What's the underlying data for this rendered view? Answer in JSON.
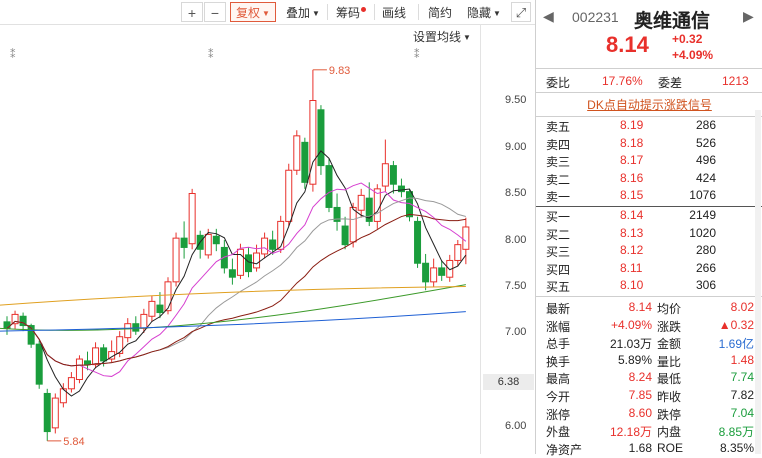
{
  "toolbar": {
    "glyphs": {
      "plus": "+",
      "minus": "−",
      "prev": "◀",
      "next": "▶"
    },
    "fuquan": "复权",
    "diejia": "叠加",
    "choumа": "筹码",
    "huaxian": "画线",
    "jianyue": "简约",
    "yincang": "隐藏",
    "expand_glyph": "⤢"
  },
  "chart": {
    "avg_setting": "设置均线",
    "high_label": "9.83",
    "low_label": "5.84",
    "marker_glyph": "⁑",
    "y_ticks": [
      "9.50",
      "9.00",
      "8.50",
      "8.00",
      "7.50",
      "7.00",
      "6.00"
    ],
    "current_price_tag": "6.38"
  },
  "quote": {
    "code": "002231",
    "name": "奥维通信",
    "price": "8.14",
    "change": "+0.32",
    "change_pct": "+4.09%",
    "weibi_label": "委比",
    "weibi": "17.76%",
    "weicha_label": "委差",
    "weicha": "1213",
    "dk_text": "DK点自动提示涨跌信号"
  },
  "sell_orders": [
    {
      "label": "卖五",
      "price": "8.19",
      "vol": "286"
    },
    {
      "label": "卖四",
      "price": "8.18",
      "vol": "526"
    },
    {
      "label": "卖三",
      "price": "8.17",
      "vol": "496"
    },
    {
      "label": "卖二",
      "price": "8.16",
      "vol": "424"
    },
    {
      "label": "卖一",
      "price": "8.15",
      "vol": "1076"
    }
  ],
  "buy_orders": [
    {
      "label": "买一",
      "price": "8.14",
      "vol": "2149"
    },
    {
      "label": "买二",
      "price": "8.13",
      "vol": "1020"
    },
    {
      "label": "买三",
      "price": "8.12",
      "vol": "280"
    },
    {
      "label": "买四",
      "price": "8.11",
      "vol": "266"
    },
    {
      "label": "买五",
      "price": "8.10",
      "vol": "306"
    }
  ],
  "stats": [
    {
      "l1": "最新",
      "v1": "8.14",
      "c1": "red",
      "l2": "均价",
      "v2": "8.02",
      "c2": "red"
    },
    {
      "l1": "涨幅",
      "v1": "+4.09%",
      "c1": "red",
      "l2": "涨跌",
      "v2": "▲0.32",
      "c2": "red"
    },
    {
      "l1": "总手",
      "v1": "21.03万",
      "c1": "",
      "l2": "金额",
      "v2": "1.69亿",
      "c2": "blue"
    },
    {
      "l1": "换手",
      "v1": "5.89%",
      "c1": "",
      "l2": "量比",
      "v2": "1.48",
      "c2": "red"
    },
    {
      "l1": "最高",
      "v1": "8.24",
      "c1": "red",
      "l2": "最低",
      "v2": "7.74",
      "c2": "green"
    },
    {
      "l1": "今开",
      "v1": "7.85",
      "c1": "red",
      "l2": "昨收",
      "v2": "7.82",
      "c2": ""
    },
    {
      "l1": "涨停",
      "v1": "8.60",
      "c1": "red",
      "l2": "跌停",
      "v2": "7.04",
      "c2": "green"
    },
    {
      "l1": "外盘",
      "v1": "12.18万",
      "c1": "red",
      "l2": "内盘",
      "v2": "8.85万",
      "c2": "green"
    },
    {
      "l1": "净资产",
      "v1": "1.68",
      "c1": "",
      "l2": "ROE",
      "v2": "8.35%",
      "c2": ""
    }
  ],
  "colors": {
    "up": "#e8302b",
    "down": "#1a9d3c",
    "accent": "#e05a3b",
    "ma5": "#222222",
    "ma10": "#d63fd0",
    "ma20": "#9a9a9a",
    "ma30": "#8a1d12",
    "ma60": "#3c9a2a",
    "ma120": "#1e5fd4",
    "ma250": "#e0a020"
  }
}
